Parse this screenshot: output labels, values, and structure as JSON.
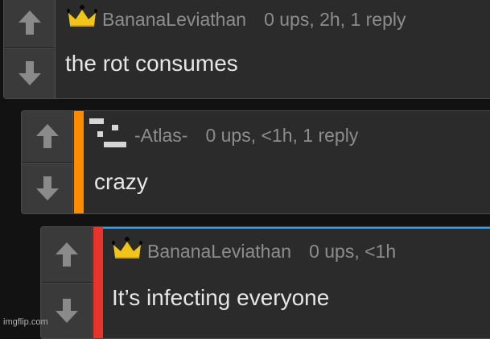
{
  "comments": [
    {
      "username": "BananaLeviathan",
      "meta": "0 ups, 2h, 1 reply",
      "text": "the rot consumes",
      "badge_icon": "crown-icon"
    },
    {
      "username": "-Atlas-",
      "meta": "0 ups, <1h, 1 reply",
      "text": "crazy",
      "badge_icon": "pixel-avatar-icon",
      "depth_color": "#ff8c00"
    },
    {
      "username": "BananaLeviathan",
      "meta": "0 ups, <1h",
      "text": "It’s infecting everyone",
      "badge_icon": "crown-icon",
      "depth_color": "#e8342b"
    }
  ],
  "vote_icons": {
    "up": "arrow-up-icon",
    "down": "arrow-down-icon"
  },
  "watermark": "imgflip.com"
}
